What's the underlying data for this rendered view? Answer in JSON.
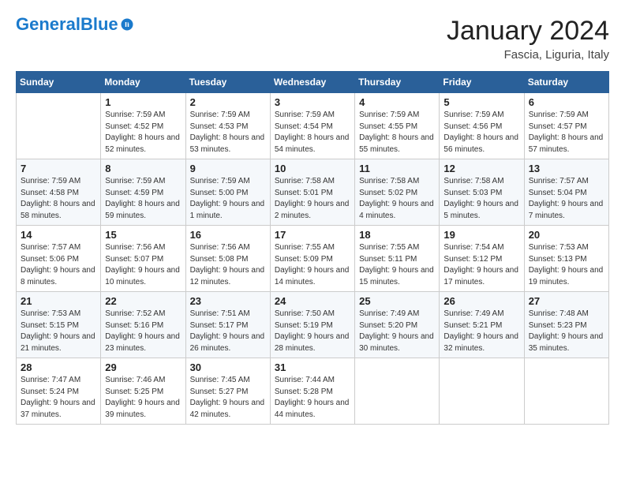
{
  "header": {
    "logo_general": "General",
    "logo_blue": "Blue",
    "month_year": "January 2024",
    "location": "Fascia, Liguria, Italy"
  },
  "weekdays": [
    "Sunday",
    "Monday",
    "Tuesday",
    "Wednesday",
    "Thursday",
    "Friday",
    "Saturday"
  ],
  "weeks": [
    [
      {
        "day": "",
        "sunrise": "",
        "sunset": "",
        "daylight": ""
      },
      {
        "day": "1",
        "sunrise": "Sunrise: 7:59 AM",
        "sunset": "Sunset: 4:52 PM",
        "daylight": "Daylight: 8 hours and 52 minutes."
      },
      {
        "day": "2",
        "sunrise": "Sunrise: 7:59 AM",
        "sunset": "Sunset: 4:53 PM",
        "daylight": "Daylight: 8 hours and 53 minutes."
      },
      {
        "day": "3",
        "sunrise": "Sunrise: 7:59 AM",
        "sunset": "Sunset: 4:54 PM",
        "daylight": "Daylight: 8 hours and 54 minutes."
      },
      {
        "day": "4",
        "sunrise": "Sunrise: 7:59 AM",
        "sunset": "Sunset: 4:55 PM",
        "daylight": "Daylight: 8 hours and 55 minutes."
      },
      {
        "day": "5",
        "sunrise": "Sunrise: 7:59 AM",
        "sunset": "Sunset: 4:56 PM",
        "daylight": "Daylight: 8 hours and 56 minutes."
      },
      {
        "day": "6",
        "sunrise": "Sunrise: 7:59 AM",
        "sunset": "Sunset: 4:57 PM",
        "daylight": "Daylight: 8 hours and 57 minutes."
      }
    ],
    [
      {
        "day": "7",
        "sunrise": "Sunrise: 7:59 AM",
        "sunset": "Sunset: 4:58 PM",
        "daylight": "Daylight: 8 hours and 58 minutes."
      },
      {
        "day": "8",
        "sunrise": "Sunrise: 7:59 AM",
        "sunset": "Sunset: 4:59 PM",
        "daylight": "Daylight: 8 hours and 59 minutes."
      },
      {
        "day": "9",
        "sunrise": "Sunrise: 7:59 AM",
        "sunset": "Sunset: 5:00 PM",
        "daylight": "Daylight: 9 hours and 1 minute."
      },
      {
        "day": "10",
        "sunrise": "Sunrise: 7:58 AM",
        "sunset": "Sunset: 5:01 PM",
        "daylight": "Daylight: 9 hours and 2 minutes."
      },
      {
        "day": "11",
        "sunrise": "Sunrise: 7:58 AM",
        "sunset": "Sunset: 5:02 PM",
        "daylight": "Daylight: 9 hours and 4 minutes."
      },
      {
        "day": "12",
        "sunrise": "Sunrise: 7:58 AM",
        "sunset": "Sunset: 5:03 PM",
        "daylight": "Daylight: 9 hours and 5 minutes."
      },
      {
        "day": "13",
        "sunrise": "Sunrise: 7:57 AM",
        "sunset": "Sunset: 5:04 PM",
        "daylight": "Daylight: 9 hours and 7 minutes."
      }
    ],
    [
      {
        "day": "14",
        "sunrise": "Sunrise: 7:57 AM",
        "sunset": "Sunset: 5:06 PM",
        "daylight": "Daylight: 9 hours and 8 minutes."
      },
      {
        "day": "15",
        "sunrise": "Sunrise: 7:56 AM",
        "sunset": "Sunset: 5:07 PM",
        "daylight": "Daylight: 9 hours and 10 minutes."
      },
      {
        "day": "16",
        "sunrise": "Sunrise: 7:56 AM",
        "sunset": "Sunset: 5:08 PM",
        "daylight": "Daylight: 9 hours and 12 minutes."
      },
      {
        "day": "17",
        "sunrise": "Sunrise: 7:55 AM",
        "sunset": "Sunset: 5:09 PM",
        "daylight": "Daylight: 9 hours and 14 minutes."
      },
      {
        "day": "18",
        "sunrise": "Sunrise: 7:55 AM",
        "sunset": "Sunset: 5:11 PM",
        "daylight": "Daylight: 9 hours and 15 minutes."
      },
      {
        "day": "19",
        "sunrise": "Sunrise: 7:54 AM",
        "sunset": "Sunset: 5:12 PM",
        "daylight": "Daylight: 9 hours and 17 minutes."
      },
      {
        "day": "20",
        "sunrise": "Sunrise: 7:53 AM",
        "sunset": "Sunset: 5:13 PM",
        "daylight": "Daylight: 9 hours and 19 minutes."
      }
    ],
    [
      {
        "day": "21",
        "sunrise": "Sunrise: 7:53 AM",
        "sunset": "Sunset: 5:15 PM",
        "daylight": "Daylight: 9 hours and 21 minutes."
      },
      {
        "day": "22",
        "sunrise": "Sunrise: 7:52 AM",
        "sunset": "Sunset: 5:16 PM",
        "daylight": "Daylight: 9 hours and 23 minutes."
      },
      {
        "day": "23",
        "sunrise": "Sunrise: 7:51 AM",
        "sunset": "Sunset: 5:17 PM",
        "daylight": "Daylight: 9 hours and 26 minutes."
      },
      {
        "day": "24",
        "sunrise": "Sunrise: 7:50 AM",
        "sunset": "Sunset: 5:19 PM",
        "daylight": "Daylight: 9 hours and 28 minutes."
      },
      {
        "day": "25",
        "sunrise": "Sunrise: 7:49 AM",
        "sunset": "Sunset: 5:20 PM",
        "daylight": "Daylight: 9 hours and 30 minutes."
      },
      {
        "day": "26",
        "sunrise": "Sunrise: 7:49 AM",
        "sunset": "Sunset: 5:21 PM",
        "daylight": "Daylight: 9 hours and 32 minutes."
      },
      {
        "day": "27",
        "sunrise": "Sunrise: 7:48 AM",
        "sunset": "Sunset: 5:23 PM",
        "daylight": "Daylight: 9 hours and 35 minutes."
      }
    ],
    [
      {
        "day": "28",
        "sunrise": "Sunrise: 7:47 AM",
        "sunset": "Sunset: 5:24 PM",
        "daylight": "Daylight: 9 hours and 37 minutes."
      },
      {
        "day": "29",
        "sunrise": "Sunrise: 7:46 AM",
        "sunset": "Sunset: 5:25 PM",
        "daylight": "Daylight: 9 hours and 39 minutes."
      },
      {
        "day": "30",
        "sunrise": "Sunrise: 7:45 AM",
        "sunset": "Sunset: 5:27 PM",
        "daylight": "Daylight: 9 hours and 42 minutes."
      },
      {
        "day": "31",
        "sunrise": "Sunrise: 7:44 AM",
        "sunset": "Sunset: 5:28 PM",
        "daylight": "Daylight: 9 hours and 44 minutes."
      },
      {
        "day": "",
        "sunrise": "",
        "sunset": "",
        "daylight": ""
      },
      {
        "day": "",
        "sunrise": "",
        "sunset": "",
        "daylight": ""
      },
      {
        "day": "",
        "sunrise": "",
        "sunset": "",
        "daylight": ""
      }
    ]
  ]
}
